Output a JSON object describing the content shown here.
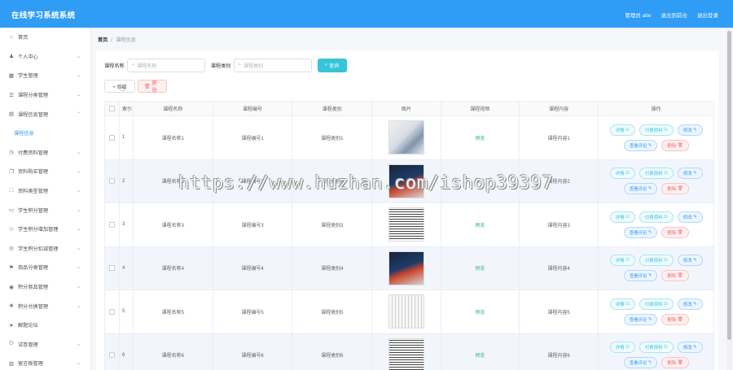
{
  "header": {
    "brand": "在线学习系统系统",
    "admin_label": "管理员 abo",
    "backend_link": "退出到前台",
    "logout_link": "退出登录"
  },
  "sidebar": {
    "items": [
      {
        "icon": "home-icon",
        "label": "首页",
        "arrow": false
      },
      {
        "icon": "user-icon",
        "label": "个人中心",
        "arrow": true
      },
      {
        "icon": "grid-icon",
        "label": "学生管理",
        "arrow": true
      },
      {
        "icon": "list-icon",
        "label": "课程分类管理",
        "arrow": true
      },
      {
        "icon": "chart-icon",
        "label": "课程信息管理",
        "arrow": true,
        "expanded": true
      },
      {
        "label": "课程信息",
        "child": true
      },
      {
        "icon": "clock-icon",
        "label": "付费资料管理",
        "arrow": true
      },
      {
        "icon": "copy-icon",
        "label": "资料购买管理",
        "arrow": true
      },
      {
        "icon": "scan-icon",
        "label": "资料类型管理",
        "arrow": true
      },
      {
        "icon": "file-icon",
        "label": "学生积分管理",
        "arrow": true
      },
      {
        "icon": "bulb-icon",
        "label": "学生积分增加管理",
        "arrow": true
      },
      {
        "icon": "circle-icon",
        "label": "学生积分扣减管理",
        "arrow": true
      },
      {
        "icon": "flag-icon",
        "label": "商品分类管理",
        "arrow": true
      },
      {
        "icon": "cart-icon",
        "label": "积分商品管理",
        "arrow": true
      },
      {
        "icon": "gift-icon",
        "label": "积分兑换管理",
        "arrow": true
      },
      {
        "icon": "send-icon",
        "label": "解题论坛",
        "arrow": false
      },
      {
        "icon": "power-icon",
        "label": "试卷管理",
        "arrow": true
      },
      {
        "icon": "building-icon",
        "label": "留言板管理",
        "arrow": true
      }
    ]
  },
  "breadcrumb": {
    "home": "首页",
    "separator": "/",
    "current": "课程信息"
  },
  "search": {
    "name_label": "课程名称",
    "name_placeholder": "课程名称",
    "category_label": "课程类别",
    "category_placeholder": "课程类别",
    "button": "查询"
  },
  "actions": {
    "add": "+ 新增",
    "delete": "删除"
  },
  "table": {
    "headers": {
      "index": "索引",
      "name": "课程名称",
      "code": "课程编号",
      "category": "课程类别",
      "image": "图片",
      "video": "课程视频",
      "content": "课程内容",
      "ops": "操作"
    },
    "ops_labels": {
      "detail": "详情",
      "paid": "付费资料",
      "edit": "修改",
      "comments": "查看评论",
      "delete": "删除"
    },
    "rows": [
      {
        "index": "1",
        "name": "课程名称1",
        "code": "课程编号1",
        "category": "课程类别1",
        "image": "flow",
        "video": "预览",
        "content": "课程内容1"
      },
      {
        "index": "2",
        "name": "课程名称2",
        "code": "课程编号2",
        "category": "课程类别2",
        "image": "biz",
        "video": "预览",
        "content": "课程内容2"
      },
      {
        "index": "3",
        "name": "课程名称3",
        "code": "课程编号3",
        "category": "课程类别3",
        "image": "words",
        "video": "预览",
        "content": "课程内容3"
      },
      {
        "index": "4",
        "name": "课程名称4",
        "code": "课程编号4",
        "category": "课程类别4",
        "image": "biz",
        "video": "预览",
        "content": "课程内容4"
      },
      {
        "index": "5",
        "name": "课程名称5",
        "code": "课程编号5",
        "category": "课程类别5",
        "image": "love",
        "video": "预览",
        "content": "课程内容5"
      },
      {
        "index": "6",
        "name": "课程名称6",
        "code": "课程编号6",
        "category": "课程类别6",
        "image": "words",
        "video": "预览",
        "content": "课程内容6"
      }
    ]
  },
  "watermark": "https://www.huzhan.com/ishop39397"
}
